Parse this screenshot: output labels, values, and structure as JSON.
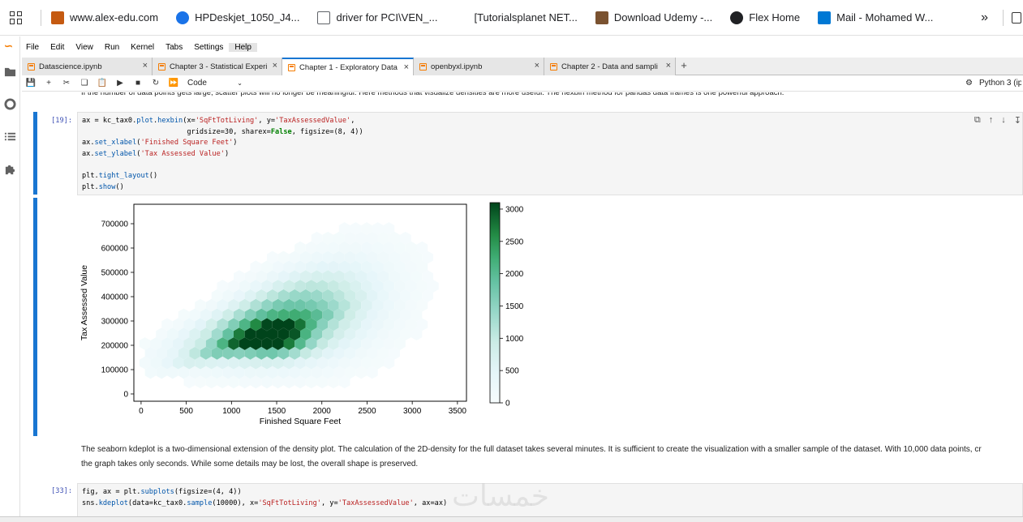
{
  "bookmarks": [
    {
      "label": "www.alex-edu.com",
      "icon": "alex-edu-favicon",
      "color": "#c55a11"
    },
    {
      "label": "HPDeskjet_1050_J4...",
      "icon": "people-icon",
      "color": "#1a73e8"
    },
    {
      "label": "driver for PCI\\VEN_...",
      "icon": "page-outline-icon",
      "color": "#5f6368"
    },
    {
      "label": "[Tutorialsplanet NET...",
      "icon": "blank-page-icon",
      "color": "#5f6368"
    },
    {
      "label": "Download Udemy -...",
      "icon": "udemy-logo-icon",
      "color": "#7a5230"
    },
    {
      "label": "Flex Home",
      "icon": "globe-icon",
      "color": "#202124"
    },
    {
      "label": "Mail - Mohamed W...",
      "icon": "outlook-icon",
      "color": "#0078d4"
    }
  ],
  "bookmarks_more": "»",
  "menu": [
    "File",
    "Edit",
    "View",
    "Run",
    "Kernel",
    "Tabs",
    "Settings",
    "Help"
  ],
  "menu_active": "Help",
  "tabs": [
    {
      "label": "Datascience.ipynb",
      "active": false
    },
    {
      "label": "Chapter 3 - Statistical Experi",
      "active": false
    },
    {
      "label": "Chapter 1 - Exploratory Data",
      "active": true
    },
    {
      "label": "openbyxl.ipynb",
      "active": false
    },
    {
      "label": "Chapter 2 - Data and sampli",
      "active": false
    }
  ],
  "tab_add": "+",
  "toolbar": {
    "cell_type": "Code",
    "kernel": "Python 3 (ip"
  },
  "top_markdown": "If the number of data points gets large, scatter plots will no longer be meaningful. Here methods that visualize densities are more useful. The  hexbin  method for pandas data frames is one powerful approach.",
  "cell19": {
    "prompt": "[19]:",
    "lines": [
      "ax = kc_tax0.plot.hexbin(x='SqFtTotLiving', y='TaxAssessedValue',",
      "                         gridsize=30, sharex=False, figsize=(8, 4))",
      "ax.set_xlabel('Finished Square Feet')",
      "ax.set_ylabel('Tax Assessed Value')",
      "",
      "plt.tight_layout()",
      "plt.show()"
    ]
  },
  "chart_data": {
    "type": "heatmap",
    "subtype": "hexbin",
    "title": "",
    "xlabel": "Finished Square Feet",
    "ylabel": "Tax Assessed Value",
    "xlim": [
      -80,
      3600
    ],
    "ylim": [
      -30000,
      780000
    ],
    "xticks": [
      0,
      500,
      1000,
      1500,
      2000,
      2500,
      3000,
      3500
    ],
    "yticks": [
      0,
      100000,
      200000,
      300000,
      400000,
      500000,
      600000,
      700000
    ],
    "colorbar": {
      "min": 0,
      "max": 3100,
      "ticks": [
        0,
        500,
        1000,
        1500,
        2000,
        2500,
        3000
      ],
      "colormap": "BuGn"
    },
    "density_peak": {
      "x": 1550,
      "y": 230000,
      "count": 3100
    },
    "notes": "2D histogram of home size vs tax assessed value; highest density along a band around 1000-2000 sq ft and 200k-300k value"
  },
  "md2": {
    "line1": "The seaborn kdeplot is a two-dimensional extension of the density plot. The calculation of the 2D-density for the full dataset takes several minutes. It is sufficient to create the visualization with a smaller sample of the dataset. With 10,000 data points, cr",
    "line2": "the graph takes only seconds. While some details may be lost, the overall shape is preserved."
  },
  "cell33": {
    "prompt": "[33]:",
    "lines": [
      "fig, ax = plt.subplots(figsize=(4, 4))",
      "sns.kdeplot(data=kc_tax0.sample(10000), x='SqFtTotLiving', y='TaxAssessedValue', ax=ax)"
    ]
  },
  "watermark": "خمسات"
}
